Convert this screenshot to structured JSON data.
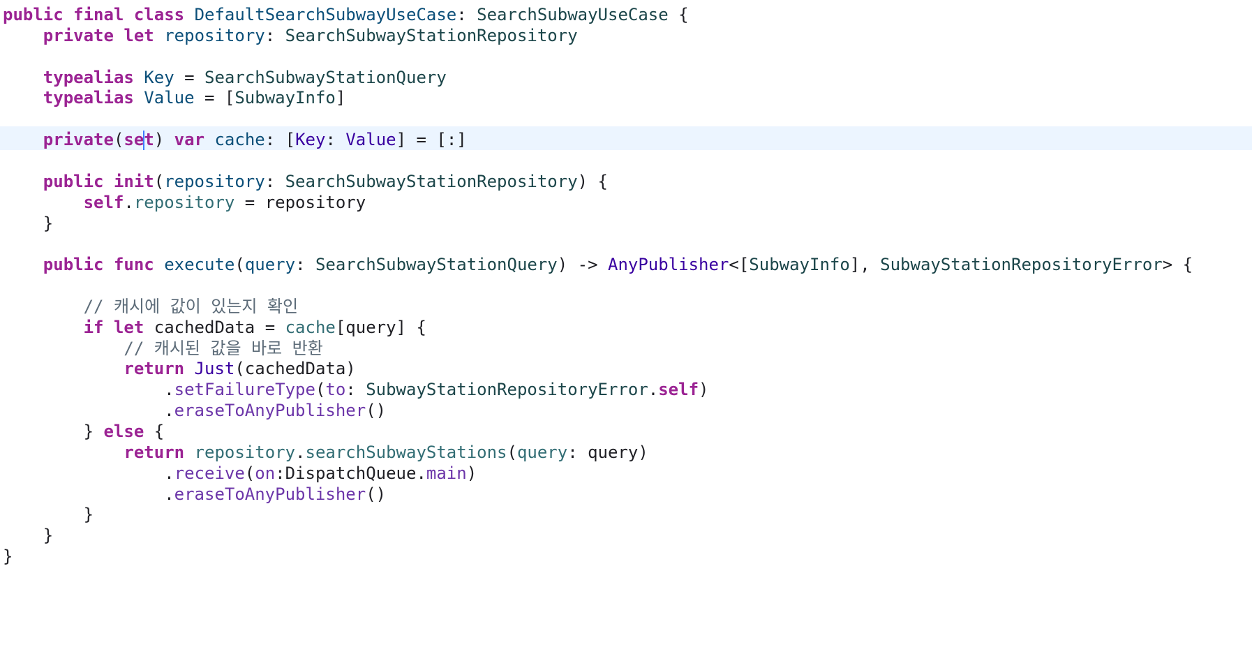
{
  "editor": {
    "language": "Swift",
    "colors": {
      "keyword": "#9b2393",
      "declared_type": "#0b4f79",
      "project_type": "#1c464a",
      "platform_type": "#3900a0",
      "platform_function": "#6c36a9",
      "project_member": "#326d74",
      "comment": "#5d6c79",
      "plain": "#1f1f24",
      "current_line_background": "#ecf5ff",
      "caret": "#3b7bff"
    },
    "highlighted_line": 7,
    "lines": [
      {
        "t": [
          [
            "kw",
            "public"
          ],
          [
            "plain",
            " "
          ],
          [
            "kw",
            "final"
          ],
          [
            "plain",
            " "
          ],
          [
            "kw",
            "class"
          ],
          [
            "plain",
            " "
          ],
          [
            "tdecl",
            "DefaultSearchSubwayUseCase"
          ],
          [
            "plain",
            ": "
          ],
          [
            "type",
            "SearchSubwayUseCase"
          ],
          [
            "plain",
            " {"
          ]
        ]
      },
      {
        "t": [
          [
            "plain",
            "    "
          ],
          [
            "kw",
            "private"
          ],
          [
            "plain",
            " "
          ],
          [
            "kw",
            "let"
          ],
          [
            "plain",
            " "
          ],
          [
            "tdecl",
            "repository"
          ],
          [
            "plain",
            ": "
          ],
          [
            "type",
            "SearchSubwayStationRepository"
          ]
        ]
      },
      {
        "t": []
      },
      {
        "t": [
          [
            "plain",
            "    "
          ],
          [
            "kw",
            "typealias"
          ],
          [
            "plain",
            " "
          ],
          [
            "tdecl",
            "Key"
          ],
          [
            "plain",
            " = "
          ],
          [
            "type",
            "SearchSubwayStationQuery"
          ]
        ]
      },
      {
        "t": [
          [
            "plain",
            "    "
          ],
          [
            "kw",
            "typealias"
          ],
          [
            "plain",
            " "
          ],
          [
            "tdecl",
            "Value"
          ],
          [
            "plain",
            " = ["
          ],
          [
            "type",
            "SubwayInfo"
          ],
          [
            "plain",
            "]"
          ]
        ]
      },
      {
        "t": []
      },
      {
        "t": [
          [
            "plain",
            "    "
          ],
          [
            "kw",
            "private"
          ],
          [
            "plain",
            "("
          ],
          [
            "kw",
            "se"
          ],
          [
            "caret",
            ""
          ],
          [
            "kw",
            "t"
          ],
          [
            "plain",
            ") "
          ],
          [
            "kw",
            "var"
          ],
          [
            "plain",
            " "
          ],
          [
            "tdecl",
            "cache"
          ],
          [
            "plain",
            ": ["
          ],
          [
            "ptype",
            "Key"
          ],
          [
            "plain",
            ": "
          ],
          [
            "ptype",
            "Value"
          ],
          [
            "plain",
            "] = [:]"
          ]
        ]
      },
      {
        "t": []
      },
      {
        "t": [
          [
            "plain",
            "    "
          ],
          [
            "kw",
            "public"
          ],
          [
            "plain",
            " "
          ],
          [
            "kw",
            "init"
          ],
          [
            "plain",
            "("
          ],
          [
            "tdecl",
            "repository"
          ],
          [
            "plain",
            ": "
          ],
          [
            "type",
            "SearchSubwayStationRepository"
          ],
          [
            "plain",
            ") {"
          ]
        ]
      },
      {
        "t": [
          [
            "plain",
            "        "
          ],
          [
            "kw",
            "self"
          ],
          [
            "plain",
            "."
          ],
          [
            "proj",
            "repository"
          ],
          [
            "plain",
            " = repository"
          ]
        ]
      },
      {
        "t": [
          [
            "plain",
            "    }"
          ]
        ]
      },
      {
        "t": []
      },
      {
        "t": [
          [
            "plain",
            "    "
          ],
          [
            "kw",
            "public"
          ],
          [
            "plain",
            " "
          ],
          [
            "kw",
            "func"
          ],
          [
            "plain",
            " "
          ],
          [
            "tdecl",
            "execute"
          ],
          [
            "plain",
            "("
          ],
          [
            "tdecl",
            "query"
          ],
          [
            "plain",
            ": "
          ],
          [
            "type",
            "SearchSubwayStationQuery"
          ],
          [
            "plain",
            ") -> "
          ],
          [
            "ptype",
            "AnyPublisher"
          ],
          [
            "plain",
            "<["
          ],
          [
            "type",
            "SubwayInfo"
          ],
          [
            "plain",
            "], "
          ],
          [
            "type",
            "SubwayStationRepositoryError"
          ],
          [
            "plain",
            "> {"
          ]
        ]
      },
      {
        "t": []
      },
      {
        "t": [
          [
            "plain",
            "        "
          ],
          [
            "comment",
            "// 캐시에 값이 있는지 확인"
          ]
        ]
      },
      {
        "t": [
          [
            "plain",
            "        "
          ],
          [
            "kw",
            "if"
          ],
          [
            "plain",
            " "
          ],
          [
            "kw",
            "let"
          ],
          [
            "plain",
            " cachedData = "
          ],
          [
            "proj",
            "cache"
          ],
          [
            "plain",
            "[query] {"
          ]
        ]
      },
      {
        "t": [
          [
            "plain",
            "            "
          ],
          [
            "comment",
            "// 캐시된 값을 바로 반환"
          ]
        ]
      },
      {
        "t": [
          [
            "plain",
            "            "
          ],
          [
            "kw",
            "return"
          ],
          [
            "plain",
            " "
          ],
          [
            "ptype",
            "Just"
          ],
          [
            "plain",
            "(cachedData)"
          ]
        ]
      },
      {
        "t": [
          [
            "plain",
            "                ."
          ],
          [
            "pfunc",
            "setFailureType"
          ],
          [
            "plain",
            "("
          ],
          [
            "pfunc",
            "to"
          ],
          [
            "plain",
            ": "
          ],
          [
            "type",
            "SubwayStationRepositoryError"
          ],
          [
            "plain",
            "."
          ],
          [
            "kw",
            "self"
          ],
          [
            "plain",
            ")"
          ]
        ]
      },
      {
        "t": [
          [
            "plain",
            "                ."
          ],
          [
            "pfunc",
            "eraseToAnyPublisher"
          ],
          [
            "plain",
            "()"
          ]
        ]
      },
      {
        "t": [
          [
            "plain",
            "        } "
          ],
          [
            "kw",
            "else"
          ],
          [
            "plain",
            " {"
          ]
        ]
      },
      {
        "t": [
          [
            "plain",
            "            "
          ],
          [
            "kw",
            "return"
          ],
          [
            "plain",
            " "
          ],
          [
            "proj",
            "repository"
          ],
          [
            "plain",
            "."
          ],
          [
            "proj",
            "searchSubwayStations"
          ],
          [
            "plain",
            "("
          ],
          [
            "param",
            "query"
          ],
          [
            "plain",
            ": query)"
          ]
        ]
      },
      {
        "t": [
          [
            "plain",
            "                ."
          ],
          [
            "pfunc",
            "receive"
          ],
          [
            "plain",
            "("
          ],
          [
            "pfunc",
            "on"
          ],
          [
            "plain",
            ":DispatchQueue."
          ],
          [
            "pfunc",
            "main"
          ],
          [
            "plain",
            ")"
          ]
        ]
      },
      {
        "t": [
          [
            "plain",
            "                ."
          ],
          [
            "pfunc",
            "eraseToAnyPublisher"
          ],
          [
            "plain",
            "()"
          ]
        ]
      },
      {
        "t": [
          [
            "plain",
            "        }"
          ]
        ]
      },
      {
        "t": [
          [
            "plain",
            "    }"
          ]
        ]
      },
      {
        "t": [
          [
            "plain",
            "}"
          ]
        ]
      }
    ]
  }
}
